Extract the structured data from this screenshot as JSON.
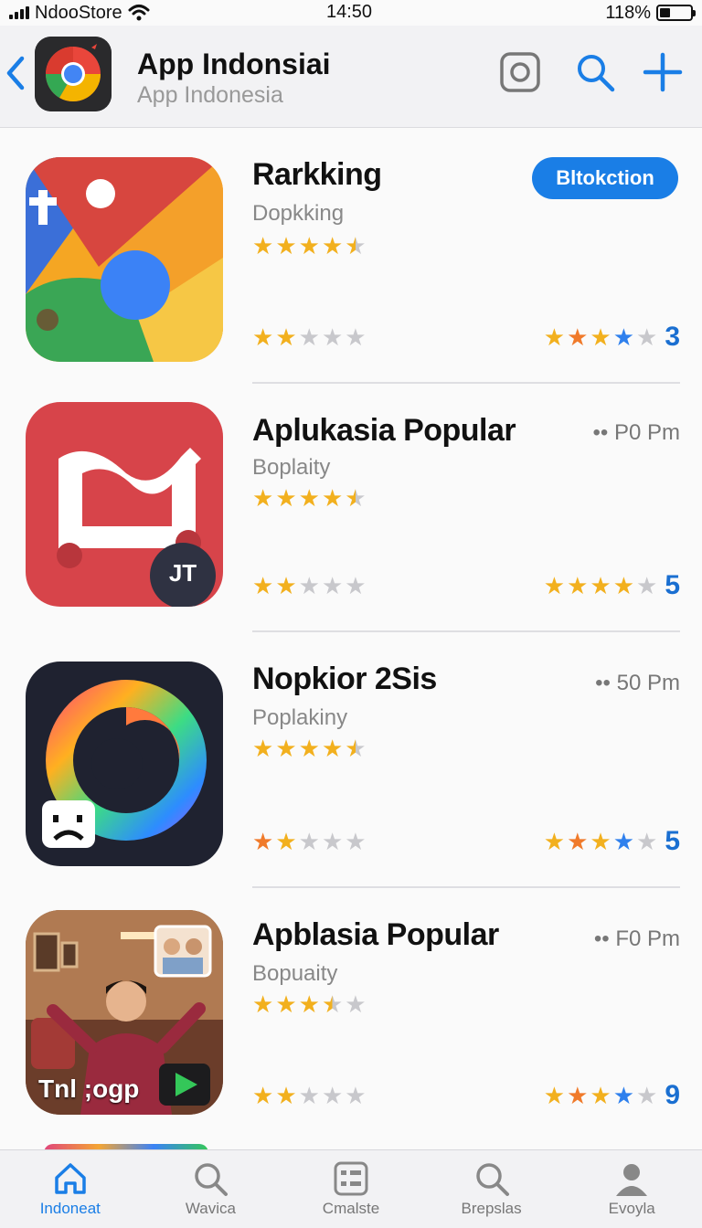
{
  "status_bar": {
    "carrier": "NdooStore",
    "time": "14:50",
    "battery": "118%",
    "battery_level": 0.35
  },
  "header": {
    "title": "App Indonsiai",
    "subtitle": "App Indonesia",
    "icons": [
      "back-chevron-icon",
      "camera-icon",
      "search-icon",
      "plus-icon"
    ]
  },
  "apps": [
    {
      "name": "Rarkking",
      "category": "Dopkking",
      "rating_top": 4.5,
      "rating_bottom": 2,
      "right_rating": 4,
      "right_count": "3",
      "action": "Bltokction",
      "meta": ""
    },
    {
      "name": "Aplukasia Popular",
      "category": "Boplaity",
      "rating_top": 4.5,
      "rating_bottom": 2,
      "right_rating": 4,
      "right_count": "5",
      "action": "",
      "meta": "•• P0 Pm"
    },
    {
      "name": "Nopkior 2Sis",
      "category": "Poplakiny",
      "rating_top": 4.5,
      "rating_bottom": 2,
      "right_rating": 4,
      "right_count": "5",
      "action": "",
      "meta": "•• 50 Pm"
    },
    {
      "name": "Apblasia Popular",
      "category": "Bopuaity",
      "rating_top": 3.5,
      "rating_bottom": 2,
      "right_rating": 4,
      "right_count": "9",
      "action": "",
      "meta": "•• F0 Pm",
      "icon_overlay": "Tnl ;ogp"
    }
  ],
  "badges": {
    "app2_badge": "JT"
  },
  "tabs": [
    {
      "label": "Indoneat",
      "icon": "home-icon",
      "active": true
    },
    {
      "label": "Wavica",
      "icon": "search-icon",
      "active": false
    },
    {
      "label": "Cmalste",
      "icon": "grid-list-icon",
      "active": false
    },
    {
      "label": "Brepslas",
      "icon": "search-icon",
      "active": false
    },
    {
      "label": "Evoyla",
      "icon": "person-icon",
      "active": false
    }
  ],
  "colors": {
    "accent": "#1a7ee6",
    "star_gold": "#f2b01e",
    "star_orange": "#f07a2a",
    "star_blue": "#2f80ed",
    "star_gray": "#c8c8cc"
  }
}
